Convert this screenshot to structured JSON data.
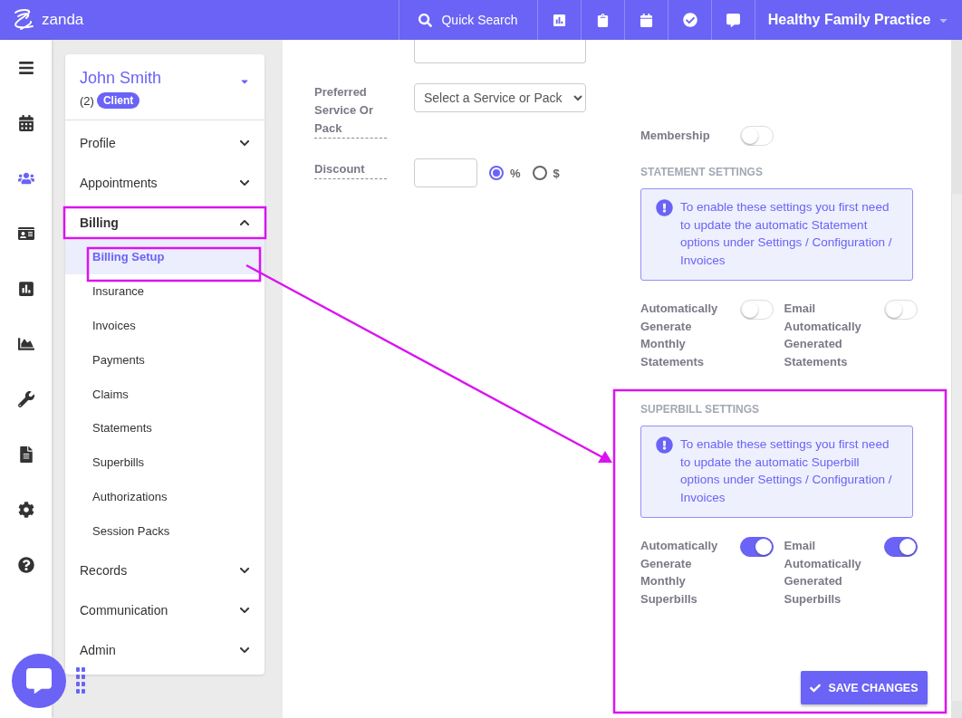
{
  "topbar": {
    "logo": "zanda",
    "search": "Quick Search",
    "practice": "Healthy Family Practice"
  },
  "rail": [
    {
      "kind": "menu",
      "selected": false
    },
    {
      "kind": "calendar",
      "selected": false
    },
    {
      "kind": "users",
      "selected": true
    },
    {
      "kind": "card",
      "selected": false
    },
    {
      "kind": "report",
      "selected": false
    },
    {
      "kind": "area",
      "selected": false
    },
    {
      "kind": "wrench",
      "selected": false
    },
    {
      "kind": "file",
      "selected": false
    },
    {
      "kind": "gear",
      "selected": false
    },
    {
      "kind": "help",
      "selected": false
    }
  ],
  "client": {
    "name": "John Smith",
    "count": "(2)",
    "badge": "Client"
  },
  "nav": [
    {
      "label": "Profile",
      "expanded": false
    },
    {
      "label": "Appointments",
      "expanded": false
    },
    {
      "label": "Billing",
      "expanded": true,
      "children": [
        {
          "label": "Billing Setup",
          "selected": true
        },
        {
          "label": "Insurance",
          "selected": false
        },
        {
          "label": "Invoices",
          "selected": false
        },
        {
          "label": "Payments",
          "selected": false
        },
        {
          "label": "Claims",
          "selected": false
        },
        {
          "label": "Statements",
          "selected": false
        },
        {
          "label": "Superbills",
          "selected": false
        },
        {
          "label": "Authorizations",
          "selected": false
        },
        {
          "label": "Session Packs",
          "selected": false
        }
      ]
    },
    {
      "label": "Records",
      "expanded": false
    },
    {
      "label": "Communication",
      "expanded": false
    },
    {
      "label": "Admin",
      "expanded": false
    }
  ],
  "form": {
    "preferred_label": "Preferred Service Or Pack",
    "preferred_select": "Select a Service or Pack",
    "discount_label": "Discount",
    "discount_units": [
      {
        "label": "%",
        "selected": true
      },
      {
        "label": "$",
        "selected": false
      }
    ]
  },
  "membership": {
    "label": "Membership",
    "on": false
  },
  "sections": [
    {
      "title": "STATEMENT SETTINGS",
      "alert": "To enable these settings you first need to update the automatic Statement options under Settings / Configuration / Invoices",
      "toggles": [
        {
          "label": "Automatically Generate Monthly Statements",
          "on": false
        },
        {
          "label": "Email Automatically Generated Statements",
          "on": false
        }
      ]
    },
    {
      "title": "SUPERBILL SETTINGS",
      "alert": "To enable these settings you first need to update the automatic Superbill options under Settings / Configuration / Invoices",
      "toggles": [
        {
          "label": "Automatically Generate Monthly Superbills",
          "on": true
        },
        {
          "label": "Email Automatically Generated Superbills",
          "on": true
        }
      ]
    }
  ],
  "save_button": "SAVE CHANGES"
}
